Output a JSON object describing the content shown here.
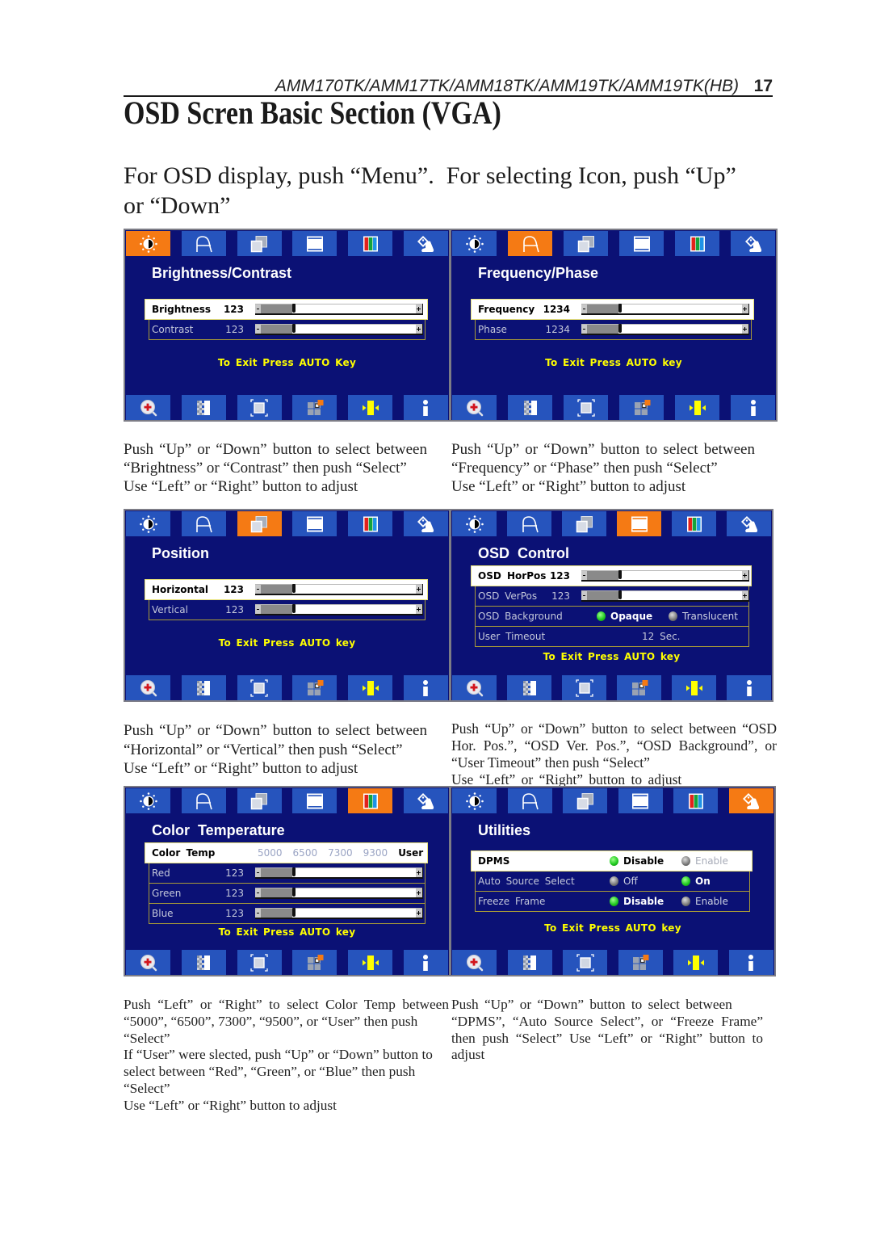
{
  "header": {
    "models": "AMM170TK/AMM17TK/AMM18TK/AMM19TK/AMM19TK(HB)",
    "page_number": "17"
  },
  "title": "OSD Scren Basic Section (VGA)",
  "intro": [
    "For OSD display, push “Menu”.  For selecting Icon, push “Up”",
    "or “Down”"
  ],
  "menu_tab_icons": [
    "brightness-contrast-icon",
    "frequency-phase-icon",
    "position-icon",
    "osd-window-icon",
    "color-bars-icon",
    "utilities-hand-icon"
  ],
  "function_tab_icons": [
    "zoom-in-icon",
    "sharpness-icon",
    "expand-corners-icon",
    "grid-squares-icon",
    "inward-arrows-icon",
    "info-icon"
  ],
  "colors": {
    "osd_background": "#0b1175",
    "tab_tile": "#2654bd",
    "tab_active": "#f57a14",
    "exit_hint": "#ffff00",
    "row_border": "#a89a38",
    "option_on": "#22cc22",
    "option_off": "#808080"
  },
  "panels": [
    {
      "title": "Brightness/Contrast",
      "active_tab": 0,
      "rows": [
        {
          "label": "Brightness",
          "value": "123",
          "slider_level": 0.23,
          "selected": true
        },
        {
          "label": "Contrast",
          "value": "123",
          "slider_level": 0.23,
          "selected": false
        }
      ],
      "exit_hint": "To Exit Press AUTO Key",
      "caption": [
        "Push “Up” or “Down” button to select between",
        "“Brightness” or “Contrast” then push “Select”",
        "Use “Left” or “Right” button to adjust"
      ]
    },
    {
      "title": "Frequency/Phase",
      "active_tab": 1,
      "rows": [
        {
          "label": "Frequency",
          "value": "1234",
          "slider_level": 0.23,
          "selected": true
        },
        {
          "label": "Phase",
          "value": "1234",
          "slider_level": 0.23,
          "selected": false
        }
      ],
      "exit_hint": "To Exit Press AUTO key",
      "caption": [
        "Push “Up” or “Down” button to select between",
        "“Frequency” or “Phase” then push “Select”",
        "Use “Left” or “Right” button to adjust"
      ]
    },
    {
      "title": "Position",
      "active_tab": 2,
      "rows": [
        {
          "label": "Horizontal",
          "value": "123",
          "slider_level": 0.23,
          "selected": true
        },
        {
          "label": "Vertical",
          "value": "123",
          "slider_level": 0.23,
          "selected": false
        }
      ],
      "exit_hint": "To Exit Press AUTO key",
      "caption": [
        "Push “Up” or “Down” button to select between",
        "“Horizontal” or “Vertical” then push “Select”",
        "Use “Left” or “Right” button to adjust"
      ]
    },
    {
      "title": "OSD Control",
      "active_tab": 3,
      "rows": [
        {
          "label": "OSD HorPos",
          "value": "123",
          "slider_level": 0.23,
          "selected": true
        },
        {
          "label": "OSD VerPos",
          "value": "123",
          "slider_level": 0.23,
          "selected": false
        },
        {
          "label": "OSD Background",
          "selected": false,
          "options": [
            {
              "label": "Opaque",
              "on": true
            },
            {
              "label": "Translucent",
              "on": false
            }
          ]
        },
        {
          "label": "User Timeout",
          "value": "12 Sec.",
          "selected": false
        }
      ],
      "exit_hint": "To Exit Press AUTO key",
      "caption": [
        "Push “Up” or “Down” button to select between “OSD",
        "Hor. Pos.”, “OSD Ver. Pos.”, “OSD Background”, or",
        "“User Timeout” then push “Select”",
        "Use “Left” or “Right” button to adjust"
      ]
    },
    {
      "title": "Color Temperature",
      "active_tab": 4,
      "rows": [
        {
          "label": "Color Temp",
          "selected": true,
          "options": [
            {
              "label": "5000",
              "on": false
            },
            {
              "label": "6500",
              "on": false
            },
            {
              "label": "7300",
              "on": false
            },
            {
              "label": "9300",
              "on": false
            },
            {
              "label": "User",
              "on": true
            }
          ]
        },
        {
          "label": "Red",
          "value": "123",
          "slider_level": 0.23,
          "selected": false
        },
        {
          "label": "Green",
          "value": "123",
          "slider_level": 0.23,
          "selected": false
        },
        {
          "label": "Blue",
          "value": "123",
          "slider_level": 0.23,
          "selected": false
        }
      ],
      "exit_hint": "To Exit Press AUTO key",
      "caption": [
        "Push “Left” or “Right” to select Color Temp between",
        "“5000”, “6500”, 7300”, “9500”, or “User” then push",
        "“Select”",
        "If “User” were slected, push “Up” or “Down” button to",
        "select between “Red”, “Green”, or “Blue” then push",
        "“Select”",
        "Use “Left” or “Right” button to adjust"
      ]
    },
    {
      "title": "Utilities",
      "active_tab": 5,
      "rows": [
        {
          "label": "DPMS",
          "selected": true,
          "options": [
            {
              "label": "Disable",
              "on": true
            },
            {
              "label": "Enable",
              "on": false
            }
          ]
        },
        {
          "label": "Auto Source Select",
          "selected": false,
          "options": [
            {
              "label": "Off",
              "on": false
            },
            {
              "label": "On",
              "on": true
            }
          ]
        },
        {
          "label": "Freeze Frame",
          "selected": false,
          "options": [
            {
              "label": "Disable",
              "on": true
            },
            {
              "label": "Enable",
              "on": false
            }
          ]
        }
      ],
      "exit_hint": "To Exit Press AUTO key",
      "caption": [
        "Push “Up” or “Down” button to select between",
        "“DPMS”, “Auto Source Select”, or “Freeze Frame”",
        "then push “Select” Use “Left” or “Right” button to",
        "adjust"
      ]
    }
  ]
}
